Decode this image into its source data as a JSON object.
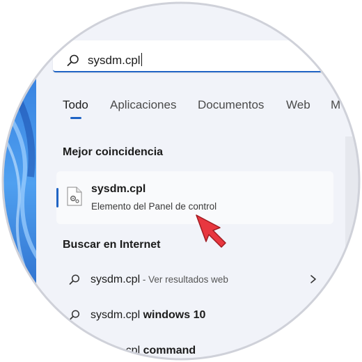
{
  "search": {
    "query": "sysdm.cpl"
  },
  "tabs": [
    {
      "label": "Todo",
      "active": true
    },
    {
      "label": "Aplicaciones"
    },
    {
      "label": "Documentos"
    },
    {
      "label": "Web"
    },
    {
      "label": "M"
    }
  ],
  "best_match": {
    "heading": "Mejor coincidencia",
    "title": "sysdm.cpl",
    "subtitle": "Elemento del Panel de control",
    "icon": "control-panel-file-icon"
  },
  "internet": {
    "heading": "Buscar en Internet",
    "results": [
      {
        "main": "sysdm.cpl",
        "suffix": " - Ver resultados web",
        "has_chevron": true
      },
      {
        "main": "sysdm.cpl ",
        "bold": "windows 10"
      },
      {
        "main": "sysdm.cpl ",
        "bold": "command"
      }
    ]
  },
  "colors": {
    "accent": "#1f63c4",
    "pointer": "#e8373f"
  }
}
